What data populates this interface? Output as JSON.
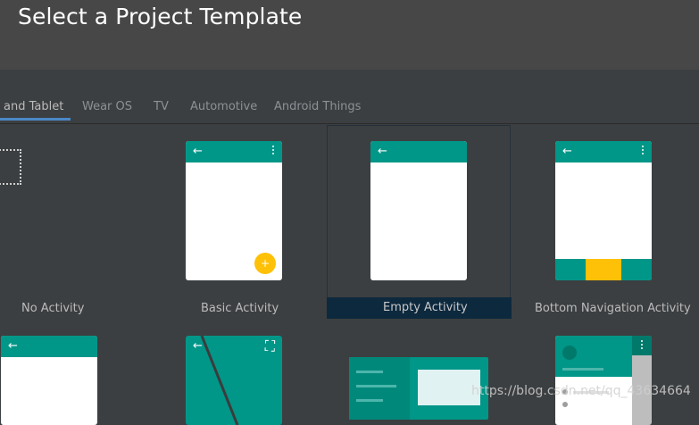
{
  "header": {
    "title": "Select a Project Template"
  },
  "tabs": [
    {
      "label": "and Tablet",
      "active": true
    },
    {
      "label": "Wear OS"
    },
    {
      "label": "TV"
    },
    {
      "label": "Automotive"
    },
    {
      "label": "Android Things"
    }
  ],
  "templates": [
    {
      "label": "No Activity"
    },
    {
      "label": "Basic Activity"
    },
    {
      "label": "Empty Activity",
      "selected": true
    },
    {
      "label": "Bottom Navigation Activity"
    }
  ],
  "icons": {
    "back": "←",
    "fab": "+",
    "fullscreen": "⛶"
  },
  "colors": {
    "accent": "#009688",
    "fab": "#ffc107",
    "selection": "#0d293e",
    "tab_underline": "#4a88c7"
  },
  "watermark": "https://blog.csdn.net/qq_43634664"
}
